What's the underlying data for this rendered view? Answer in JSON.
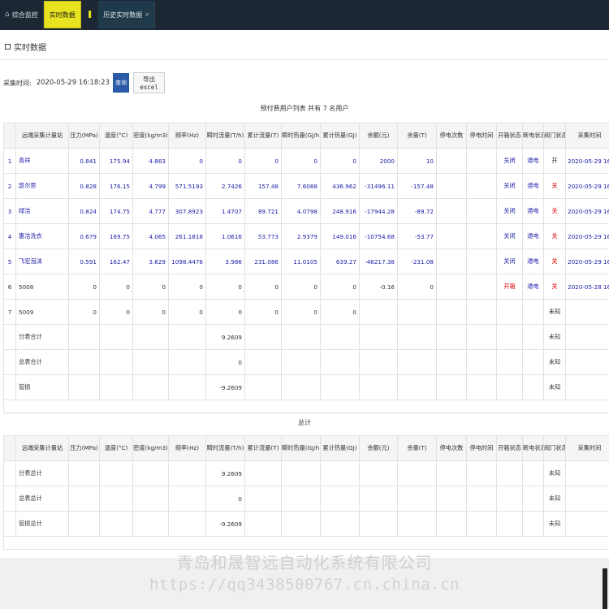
{
  "tabs": [
    {
      "label": "综合监控",
      "active": false
    },
    {
      "label": "实时数据",
      "active": true
    },
    {
      "label": "历史实时数据",
      "active": false
    }
  ],
  "section_title": "实时数据",
  "controls": {
    "time_label": "采集时间:",
    "time_value": "2020-05-29 16:18:23",
    "query_label": "查询",
    "export_label": "导出excel"
  },
  "table1": {
    "caption": "预付费用户列表 共有 7 名用户",
    "headers": [
      "远端采集计量站",
      "压力(MPa)",
      "温度(°C)",
      "密度(kg/m3)",
      "频率(Hz)",
      "瞬时流量(T/h)",
      "累计流量(T)",
      "瞬时热量(GJ/h)",
      "累计热量(GJ)",
      "余额(元)",
      "余量(T)",
      "停电次数",
      "停电时间",
      "开箱状态",
      "断电状态",
      "阀门状态",
      "采集时间"
    ],
    "rows": [
      {
        "idx": "1",
        "name": "青祥",
        "cells": [
          "0.841",
          "175.94",
          "4.863",
          "0",
          "0",
          "0",
          "0",
          "0",
          "2000",
          "10",
          "",
          "",
          "关闭",
          "通电",
          "开",
          "2020-05-29 16:18..."
        ],
        "blue": true,
        "open": "blue",
        "valve": "dark"
      },
      {
        "idx": "2",
        "name": "凯尔思",
        "cells": [
          "0.828",
          "176.15",
          "4.799",
          "571.5193",
          "2.7426",
          "157.48",
          "7.6088",
          "436.962",
          "-31496.11",
          "-157.48",
          "",
          "",
          "关闭",
          "通电",
          "关",
          "2020-05-29 16:18..."
        ],
        "blue": true,
        "open": "blue",
        "valve": "red"
      },
      {
        "idx": "3",
        "name": "绿洁",
        "cells": [
          "0.824",
          "174.75",
          "4.777",
          "307.8923",
          "1.4707",
          "89.721",
          "4.0798",
          "248.916",
          "-17944.28",
          "-89.72",
          "",
          "",
          "关闭",
          "通电",
          "关",
          "2020-05-29 16:18..."
        ],
        "blue": true,
        "open": "blue",
        "valve": "red"
      },
      {
        "idx": "4",
        "name": "惠洁洗衣",
        "cells": [
          "0.679",
          "169.75",
          "4.065",
          "261.1818",
          "1.0616",
          "53.773",
          "2.9379",
          "149.016",
          "-10754.68",
          "-53.77",
          "",
          "",
          "关闭",
          "通电",
          "关",
          "2020-05-29 16:18..."
        ],
        "blue": true,
        "open": "blue",
        "valve": "red"
      },
      {
        "idx": "5",
        "name": "飞宏泡沫",
        "cells": [
          "0.591",
          "162.47",
          "3.629",
          "1098.4476",
          "3.986",
          "231.086",
          "11.0105",
          "639.27",
          "-46217.38",
          "-231.08",
          "",
          "",
          "关闭",
          "通电",
          "关",
          "2020-05-29 16:18..."
        ],
        "blue": true,
        "open": "blue",
        "valve": "red"
      },
      {
        "idx": "6",
        "name": "5008",
        "cells": [
          "0",
          "0",
          "0",
          "0",
          "0",
          "0",
          "0",
          "0",
          "-0.16",
          "0",
          "",
          "",
          "开箱",
          "通电",
          "关",
          "2020-05-28 16:36..."
        ],
        "blue": false,
        "open": "red",
        "valve": "red"
      },
      {
        "idx": "7",
        "name": "5009",
        "cells": [
          "0",
          "0",
          "0",
          "0",
          "0",
          "0",
          "0",
          "0",
          "",
          "",
          "",
          "",
          "",
          "",
          "未知",
          ""
        ],
        "blue": false,
        "open": "dark",
        "valve": "dark"
      }
    ],
    "summary": [
      {
        "label": "分表合计",
        "flow": "9.2609",
        "valve": "未知"
      },
      {
        "label": "总表合计",
        "flow": "0",
        "valve": "未知"
      },
      {
        "label": "管损",
        "flow": "-9.2609",
        "valve": "未知"
      }
    ]
  },
  "table2": {
    "caption": "总计",
    "headers": [
      "远端采集计量站",
      "压力(MPa)",
      "温度(°C)",
      "密度(kg/m3)",
      "频率(Hz)",
      "瞬时流量(T/h)",
      "累计流量(T)",
      "瞬时热量(GJ/h)",
      "累计热量(GJ)",
      "余额(元)",
      "余量(T)",
      "停电次数",
      "停电时间",
      "开箱状态",
      "断电状态",
      "阀门状态",
      "采集时间"
    ],
    "rows": [
      {
        "label": "分表总计",
        "flow": "9.2609",
        "valve": "未知"
      },
      {
        "label": "总表总计",
        "flow": "0",
        "valve": "未知"
      },
      {
        "label": "管损总计",
        "flow": "-9.2609",
        "valve": "未知"
      }
    ]
  },
  "watermark": {
    "line1": "青岛和晟智远自动化系统有限公司",
    "line2": "https://qq3438500767.cn.china.cn"
  }
}
